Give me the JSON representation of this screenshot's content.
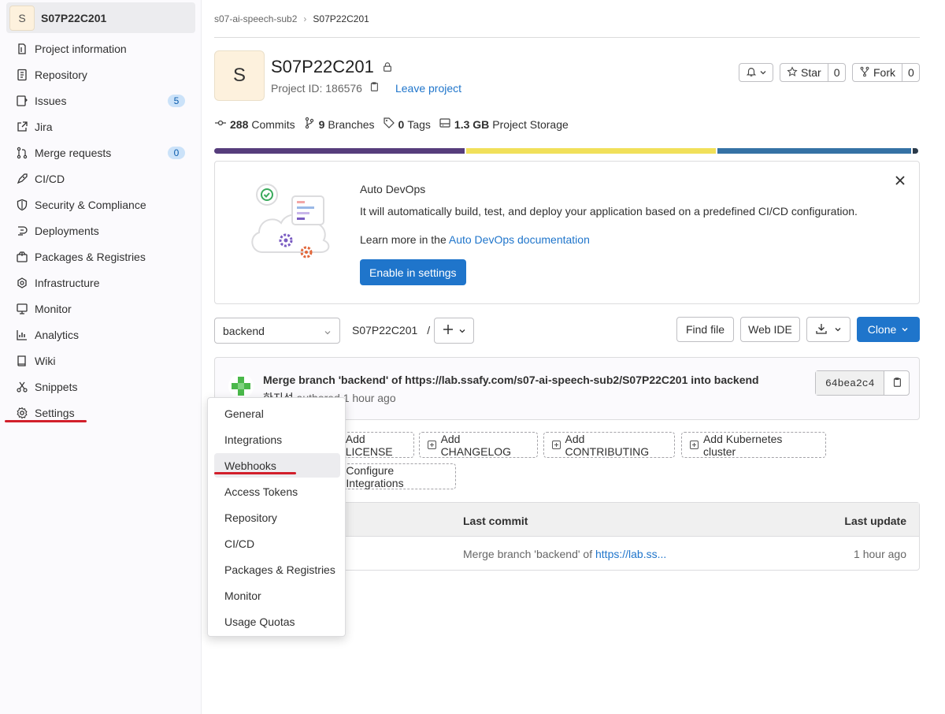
{
  "sidebar": {
    "project_initial": "S",
    "project_name": "S07P22C201",
    "items": [
      {
        "label": "Project information",
        "icon": "project-info-icon"
      },
      {
        "label": "Repository",
        "icon": "doc-icon"
      },
      {
        "label": "Issues",
        "icon": "issues-icon",
        "badge": "5"
      },
      {
        "label": "Jira",
        "icon": "external-link-icon"
      },
      {
        "label": "Merge requests",
        "icon": "merge-request-icon",
        "badge": "0"
      },
      {
        "label": "CI/CD",
        "icon": "rocket-icon"
      },
      {
        "label": "Security & Compliance",
        "icon": "shield-icon"
      },
      {
        "label": "Deployments",
        "icon": "deployments-icon"
      },
      {
        "label": "Packages & Registries",
        "icon": "package-icon"
      },
      {
        "label": "Infrastructure",
        "icon": "cloud-gear-icon"
      },
      {
        "label": "Monitor",
        "icon": "monitor-icon"
      },
      {
        "label": "Analytics",
        "icon": "chart-icon"
      },
      {
        "label": "Wiki",
        "icon": "book-icon"
      },
      {
        "label": "Snippets",
        "icon": "scissors-icon"
      },
      {
        "label": "Settings",
        "icon": "gear-icon"
      }
    ]
  },
  "breadcrumb": {
    "group": "s07-ai-speech-sub2",
    "project": "S07P22C201"
  },
  "header": {
    "initial": "S",
    "title": "S07P22C201",
    "project_id": "Project ID: 186576",
    "leave": "Leave project",
    "star_label": "Star",
    "star_count": "0",
    "fork_label": "Fork",
    "fork_count": "0"
  },
  "stats": {
    "commits_num": "288",
    "commits_label": "Commits",
    "branches_num": "9",
    "branches_label": "Branches",
    "tags_num": "0",
    "tags_label": "Tags",
    "storage_num": "1.3 GB",
    "storage_label": "Project Storage"
  },
  "language_bar_colors": [
    "#563d7c",
    "#f1e05a",
    "#3572a5",
    "#2b3b4b"
  ],
  "devops": {
    "title": "Auto DevOps",
    "text": "It will automatically build, test, and deploy your application based on a predefined CI/CD configuration.",
    "more_prefix": "Learn more in the ",
    "more_link": "Auto DevOps documentation",
    "button": "Enable in settings"
  },
  "toolbar": {
    "branch": "backend",
    "path": "S07P22C201",
    "path_sep": "/",
    "find_file": "Find file",
    "web_ide": "Web IDE",
    "clone": "Clone"
  },
  "commit": {
    "message": "Merge branch 'backend' of https://lab.ssafy.com/s07-ai-speech-sub2/S07P22C201 into backend",
    "author": "한지성",
    "authored": "authored 1 hour ago",
    "sha": "64bea2c4"
  },
  "quick_actions": {
    "license": "Add LICENSE",
    "changelog": "Add CHANGELOG",
    "contributing": "Add CONTRIBUTING",
    "kubernetes": "Add Kubernetes cluster",
    "integrations": "Configure Integrations"
  },
  "table": {
    "col_last_commit": "Last commit",
    "col_last_update": "Last update",
    "row_commit_prefix": "Merge branch 'backend' of ",
    "row_commit_link": "https://lab.ss...",
    "row_update": "1 hour ago"
  },
  "settings_menu": {
    "items": [
      "General",
      "Integrations",
      "Webhooks",
      "Access Tokens",
      "Repository",
      "CI/CD",
      "Packages & Registries",
      "Monitor",
      "Usage Quotas"
    ],
    "active": "Webhooks"
  }
}
